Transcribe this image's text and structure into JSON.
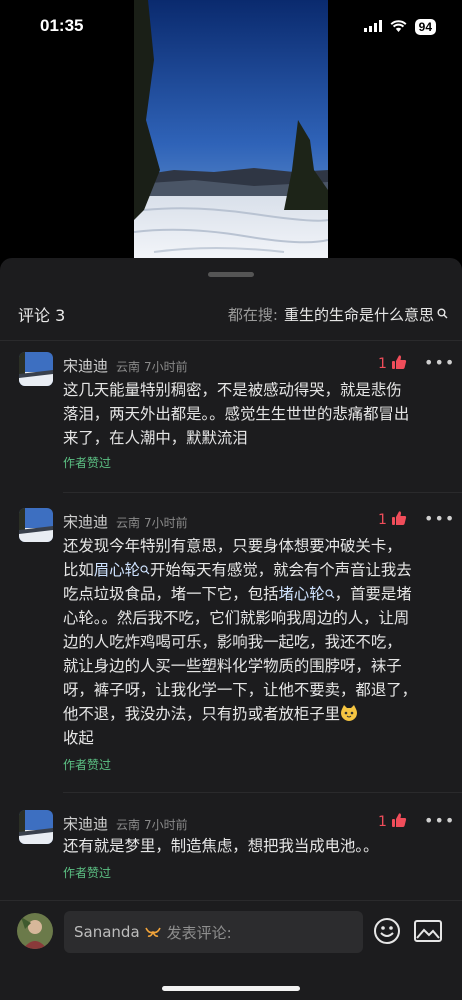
{
  "status_bar": {
    "time": "01:35",
    "battery": "94"
  },
  "comments_header": {
    "title": "评论 3",
    "search_prefix": "都在搜:",
    "search_term": "重生的生命是什么意思"
  },
  "comments": [
    {
      "username": "宋迪迪",
      "region": "云南",
      "time": "7小时前",
      "likes": "1",
      "lines": [
        "这几天能量特别稠密，不是被感动得哭，就是悲伤",
        "落泪，两天外出都是。。感觉生生世世的悲痛都冒出",
        "来了，在人潮中，默默流泪"
      ],
      "author_liked": "作者赞过"
    },
    {
      "username": "宋迪迪",
      "region": "云南",
      "time": "7小时前",
      "likes": "1",
      "line1": "还发现今年特别有意思，只要身体想要冲破关卡，",
      "line2_a": "比如",
      "line2_kw": "眉心轮",
      "line2_b": "开始每天有感觉，就会有个声音让我去",
      "line3_a": "吃点垃圾食品，堵一下它，包括",
      "line3_kw": "堵心轮",
      "line3_b": "，首要是堵",
      "rest_lines": [
        "心轮。。然后我不吃，它们就影响我周边的人，让周",
        "边的人吃炸鸡喝可乐，影响我一起吃，我还不吃，",
        "就让身边的人买一些塑料化学物质的围脖呀，袜子",
        "呀，裤子呀，让我化学一下，让他不要卖，都退了，"
      ],
      "last_line": "他不退，我没办法，只有扔或者放柜子里",
      "collapse": "收起",
      "author_liked": "作者赞过"
    },
    {
      "username": "宋迪迪",
      "region": "云南",
      "time": "7小时前",
      "likes": "1",
      "lines": [
        "还有就是梦里，制造焦虑，想把我当成电池。。"
      ],
      "author_liked": "作者赞过"
    }
  ],
  "input": {
    "username": "Sananda",
    "placeholder": "发表评论:"
  },
  "colors": {
    "like": "#f04d5a",
    "author_liked": "#5cc184",
    "sheet_bg": "#1c1c1e"
  }
}
